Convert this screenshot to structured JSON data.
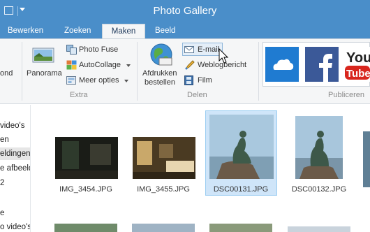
{
  "window": {
    "title": "Photo Gallery"
  },
  "tabs": [
    {
      "label": "Bewerken",
      "active": false
    },
    {
      "label": "Zoeken",
      "active": false
    },
    {
      "label": "Maken",
      "active": true
    },
    {
      "label": "Beeld",
      "active": false
    }
  ],
  "ribbon": {
    "cut_label": "ond",
    "panorama": "Panorama",
    "photo_fuse": "Photo Fuse",
    "autocollage": "AutoCollage",
    "more_options": "Meer opties",
    "extra_group": "Extra",
    "print_line1": "Afdrukken",
    "print_line2": "bestellen",
    "email": "E-mail",
    "blog": "Weblogbericht",
    "film": "Film",
    "delen_group": "Delen",
    "publish_group": "Publiceren"
  },
  "nav": {
    "items": [
      {
        "label": "video's",
        "selected": false
      },
      {
        "label": "en",
        "selected": false
      },
      {
        "label": "eldingen",
        "selected": true
      },
      {
        "label": "e afbeeld",
        "selected": false
      },
      {
        "label": "2",
        "selected": false
      },
      {
        "label": "e",
        "selected": false
      },
      {
        "label": "o video's",
        "selected": false
      }
    ]
  },
  "photos": [
    {
      "name": "IMG_3454.JPG",
      "selected": false
    },
    {
      "name": "IMG_3455.JPG",
      "selected": false
    },
    {
      "name": "DSC00131.JPG",
      "selected": true
    },
    {
      "name": "DSC00132.JPG",
      "selected": false
    }
  ],
  "colors": {
    "accent": "#4a8ec9",
    "selection": "#cfe5f9"
  }
}
